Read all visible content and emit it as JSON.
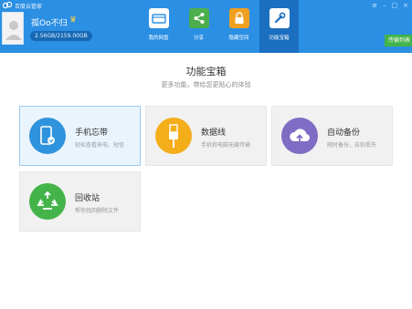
{
  "window": {
    "title": "百度云管家",
    "controls": [
      "≡",
      "–",
      "□",
      "×"
    ]
  },
  "user": {
    "name": "孤Oo不归",
    "storage": "2.56GB/2159.00GB"
  },
  "nav": {
    "items": [
      {
        "label": "我的网盘",
        "icon": "cloud-drive-icon",
        "color": "#2b8fe3"
      },
      {
        "label": "分享",
        "icon": "share-icon",
        "color": "#4cae4c"
      },
      {
        "label": "隐藏空间",
        "icon": "lock-icon",
        "color": "#f0a020"
      },
      {
        "label": "功能宝箱",
        "icon": "toolbox-icon",
        "color": "#2b8fe3",
        "active": true
      }
    ]
  },
  "transfer_button": {
    "label": "传输列表"
  },
  "main": {
    "title": "功能宝箱",
    "subtitle": "更多功能，带给您更贴心的体验"
  },
  "cards": [
    {
      "title": "手机忘带",
      "desc": "轻松查看来电、短信",
      "icon": "phone-icon",
      "color": "#2f93dd",
      "selected": true
    },
    {
      "title": "数据线",
      "desc": "手机和电脑无缝传输",
      "icon": "usb-cable-icon",
      "color": "#f4ae1a",
      "selected": false
    },
    {
      "title": "自动备份",
      "desc": "随时备份，告别丢失",
      "icon": "cloud-upload-icon",
      "color": "#7f6cc4",
      "selected": false
    },
    {
      "title": "回收站",
      "desc": "帮你找回删除文件",
      "icon": "recycle-icon",
      "color": "#44b44a",
      "selected": false
    }
  ]
}
